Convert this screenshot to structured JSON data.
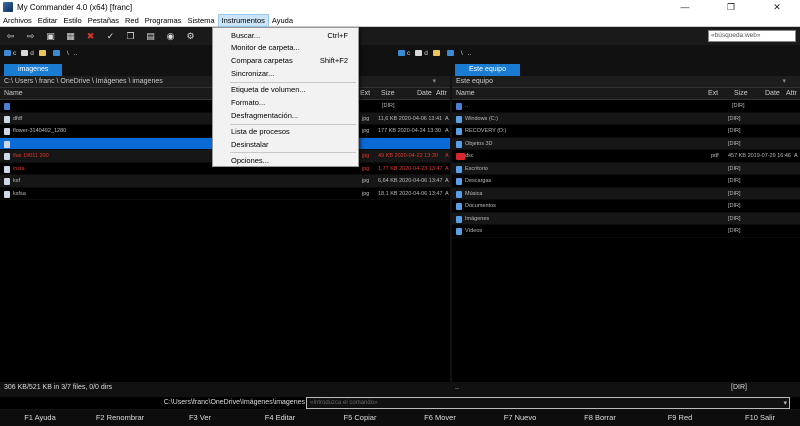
{
  "window": {
    "title": "My Commander 4.0 (x64) [franc]",
    "controls": [
      "—",
      "❐",
      "✕"
    ]
  },
  "menubar": [
    "Archivos",
    "Editar",
    "Estilo",
    "Pestañas",
    "Red",
    "Programas",
    "Sistema",
    "Instrumentos",
    "Ayuda"
  ],
  "search": {
    "placeholder": "«búsqueda:web»"
  },
  "left_drives": {
    "c": "c",
    "d": "d",
    "backslash": "\\",
    "dots": ".."
  },
  "right_drives": {
    "c": "c",
    "d": "d",
    "backslash": "\\",
    "dots": ".."
  },
  "left_tab": "imagenes",
  "right_tab": "Este equipo",
  "left_panel": {
    "path": "C:\\ Users \\ franc \\ OneDrive \\ Imágenes \\ imagenes",
    "columns": {
      "name": "Name",
      "ext": "Ext",
      "size": "Size",
      "date": "Date",
      "attr": "Attr"
    },
    "up_row": {
      "size": "[DIR]"
    },
    "rows": [
      {
        "name": "dfdf",
        "ext": "jpg",
        "size": "11,6 KB 2020-04-06 13:41",
        "attr": "A",
        "style": "alt"
      },
      {
        "name": "flower-3140492_1280",
        "ext": "jpg",
        "size": "177 KB 2020-04-24 13:30",
        "attr": "A",
        "style": ""
      },
      {
        "name": "",
        "ext": "",
        "size": "",
        "attr": "",
        "style": "selected"
      },
      {
        "name": "ifax 19011 200",
        "ext": "jpg",
        "size": "49 KB 2020-04-22 13:30",
        "attr": "A",
        "style": "red alt"
      },
      {
        "name": "insta",
        "ext": "jpg",
        "size": "1,77 KB 2020-04-23 13:47",
        "attr": "A",
        "style": "red"
      },
      {
        "name": "ksf",
        "ext": "jpg",
        "size": "6,64 KB 2020-04-06 13:47",
        "attr": "A",
        "style": "alt"
      },
      {
        "name": "ksfsa",
        "ext": "jpg",
        "size": "18,1 KB 2020-04-06 13:47",
        "attr": "A",
        "style": ""
      }
    ],
    "status": "306 KB/521 KB in 3/7 files, 0/0 dirs"
  },
  "right_panel": {
    "path": "Este equipo",
    "columns": {
      "name": "Name",
      "ext": "Ext",
      "size": "Size",
      "date": "Date",
      "attr": "Attr"
    },
    "up_row": {
      "name": "..",
      "size": "[DIR]"
    },
    "rows": [
      {
        "name": "Windows (C:)",
        "ext": "",
        "size": "[DIR]",
        "attr": "",
        "icon": "drv",
        "style": "alt"
      },
      {
        "name": "RECOVERY (D:)",
        "ext": "",
        "size": "[DIR]",
        "attr": "",
        "icon": "drv",
        "style": ""
      },
      {
        "name": "Objetos 3D",
        "ext": "",
        "size": "[DIR]",
        "attr": "",
        "icon": "drv",
        "style": "alt"
      },
      {
        "name": "dsc",
        "ext": "pdf",
        "size": "457 KB 2019-07-29 16:46",
        "attr": "A",
        "icon": "pdf",
        "style": ""
      },
      {
        "name": "Escritorio",
        "ext": "",
        "size": "[DIR]",
        "attr": "",
        "icon": "drv",
        "style": "alt"
      },
      {
        "name": "Descargas",
        "ext": "",
        "size": "[DIR]",
        "attr": "",
        "icon": "drv",
        "style": ""
      },
      {
        "name": "Música",
        "ext": "",
        "size": "[DIR]",
        "attr": "",
        "icon": "drv",
        "style": "alt"
      },
      {
        "name": "Documentos",
        "ext": "",
        "size": "[DIR]",
        "attr": "",
        "icon": "drv",
        "style": ""
      },
      {
        "name": "Imágenes",
        "ext": "",
        "size": "[DIR]",
        "attr": "",
        "icon": "drv",
        "style": "alt"
      },
      {
        "name": "Vídeos",
        "ext": "",
        "size": "[DIR]",
        "attr": "",
        "icon": "drv",
        "style": ""
      }
    ],
    "status_left": "..",
    "status_right": "[DIR]"
  },
  "command_line": {
    "path": "C:\\Users\\franc\\OneDrive\\Imágenes\\imagenes",
    "placeholder": "«Introduzca el comando»",
    "arrow": "▾"
  },
  "function_keys": [
    "F1 Ayuda",
    "F2 Renombrar",
    "F3 Ver",
    "F4 Editar",
    "F5 Copiar",
    "F6 Mover",
    "F7 Nuevo",
    "F8 Borrar",
    "F9 Red",
    "F10 Salir"
  ],
  "tools_menu": {
    "items": [
      {
        "label": "Buscar...",
        "shortcut": "Ctrl+F"
      },
      {
        "label": "Monitor de carpeta...",
        "shortcut": ""
      },
      {
        "label": "Compara carpetas",
        "shortcut": "Shift+F2"
      },
      {
        "label": "Sincronizar...",
        "shortcut": ""
      },
      {
        "label": "Etiqueta de volumen...",
        "shortcut": ""
      },
      {
        "label": "Formato...",
        "shortcut": ""
      },
      {
        "label": "Desfragmentación...",
        "shortcut": ""
      },
      {
        "label": "Lista de procesos",
        "shortcut": ""
      },
      {
        "label": "Desinstalar",
        "shortcut": ""
      },
      {
        "label": "Opciones...",
        "shortcut": ""
      }
    ]
  },
  "toolbar_icons": [
    "back-arrow-icon",
    "forward-arrow-icon",
    "view-icon",
    "grid-icon",
    "delete-icon",
    "check-icon",
    "copy-icon",
    "paste-icon",
    "drive-icon",
    "settings-icon"
  ]
}
